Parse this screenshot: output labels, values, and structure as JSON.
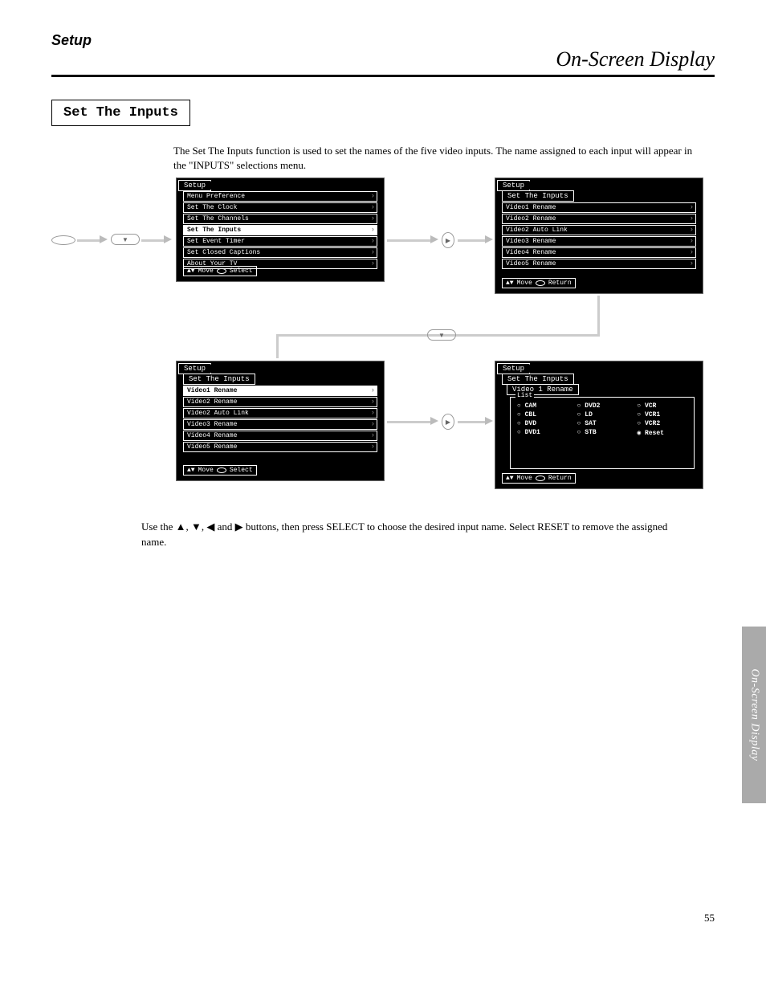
{
  "header": {
    "section": "Setup",
    "chapter": "On-Screen Display"
  },
  "box_title": "Set The Inputs",
  "intro": "The Set The Inputs function is used to set the names of the five video inputs. The name assigned to each input will appear in the \"INPUTS\" selections menu.",
  "screens": {
    "a": {
      "tab": "Setup",
      "items": [
        "Menu Preference",
        "Set The Clock",
        "Set The Channels",
        "Set The Inputs",
        "Set Event Timer",
        "Set Closed Captions",
        "About Your TV"
      ],
      "selected": 3,
      "footer_left": "Move",
      "footer_right": "Select"
    },
    "b": {
      "tab": "Setup",
      "tab2": "Set The Inputs",
      "items": [
        "Video1 Rename",
        "Video2 Rename",
        "Video2 Auto Link",
        "Video3 Rename",
        "Video4 Rename",
        "Video5 Rename"
      ],
      "selected": -1,
      "footer_left": "Move",
      "footer_right": "Return"
    },
    "c": {
      "tab": "Setup",
      "tab2": "Set The Inputs",
      "items": [
        "Video1 Rename",
        "Video2 Rename",
        "Video2 Auto Link",
        "Video3 Rename",
        "Video4 Rename",
        "Video5 Rename"
      ],
      "selected": 0,
      "footer_left": "Move",
      "footer_right": "Select"
    },
    "d": {
      "tab": "Setup",
      "tab2": "Set The Inputs",
      "tab3": "Video 1 Rename",
      "list_title": "List",
      "list": [
        [
          "CAM",
          "DVD2",
          "VCR"
        ],
        [
          "CBL",
          "LD",
          "VCR1"
        ],
        [
          "DVD",
          "SAT",
          "VCR2"
        ],
        [
          "DVD1",
          "STB",
          "Reset"
        ]
      ],
      "footer_left": "Move",
      "footer_right": "Return"
    }
  },
  "bottom_note": "Use the ▲, ▼, ◀ and ▶ buttons, then press SELECT to choose the desired input name. Select RESET to remove the assigned name.",
  "page_num": "55",
  "side_tab": "On-Screen Display"
}
